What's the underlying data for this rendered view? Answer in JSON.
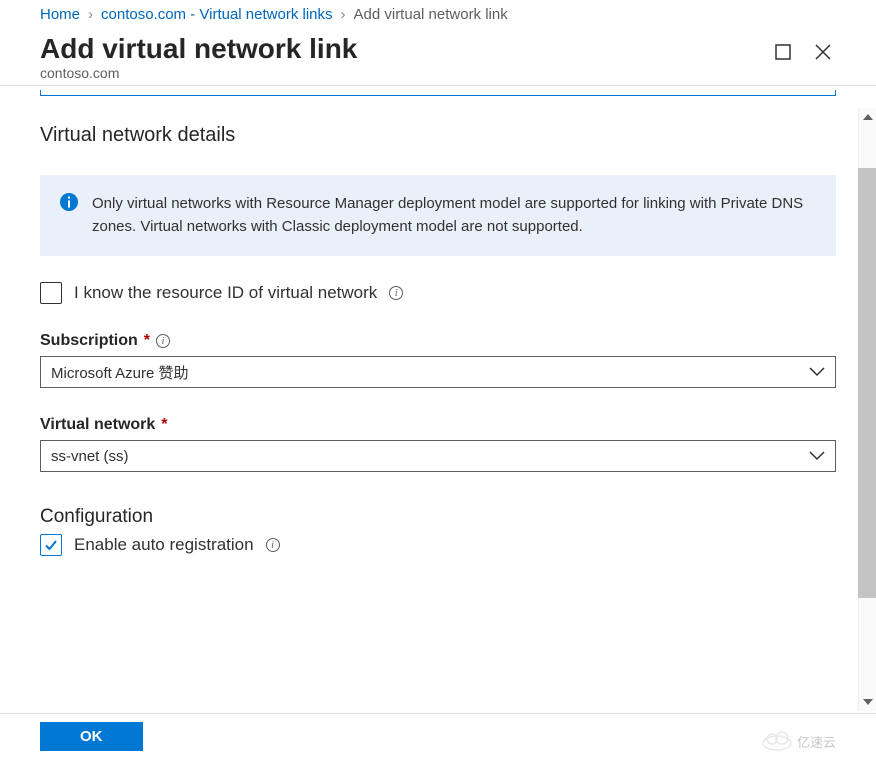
{
  "breadcrumb": {
    "home": "Home",
    "mid": "contoso.com - Virtual network links",
    "current": "Add virtual network link"
  },
  "header": {
    "title": "Add virtual network link",
    "subtitle": "contoso.com"
  },
  "section": {
    "title": "Virtual network details"
  },
  "info": {
    "text": "Only virtual networks with Resource Manager deployment model are supported for linking with Private DNS zones. Virtual networks with Classic deployment model are not supported."
  },
  "know_rid": {
    "label": "I know the resource ID of virtual network",
    "checked": false
  },
  "subscription": {
    "label": "Subscription",
    "value": "Microsoft Azure 赞助"
  },
  "vnet": {
    "label": "Virtual network",
    "value": "ss-vnet (ss)"
  },
  "config": {
    "title": "Configuration"
  },
  "auto_reg": {
    "label": "Enable auto registration",
    "checked": true
  },
  "footer": {
    "ok": "OK",
    "watermark": "亿速云"
  }
}
